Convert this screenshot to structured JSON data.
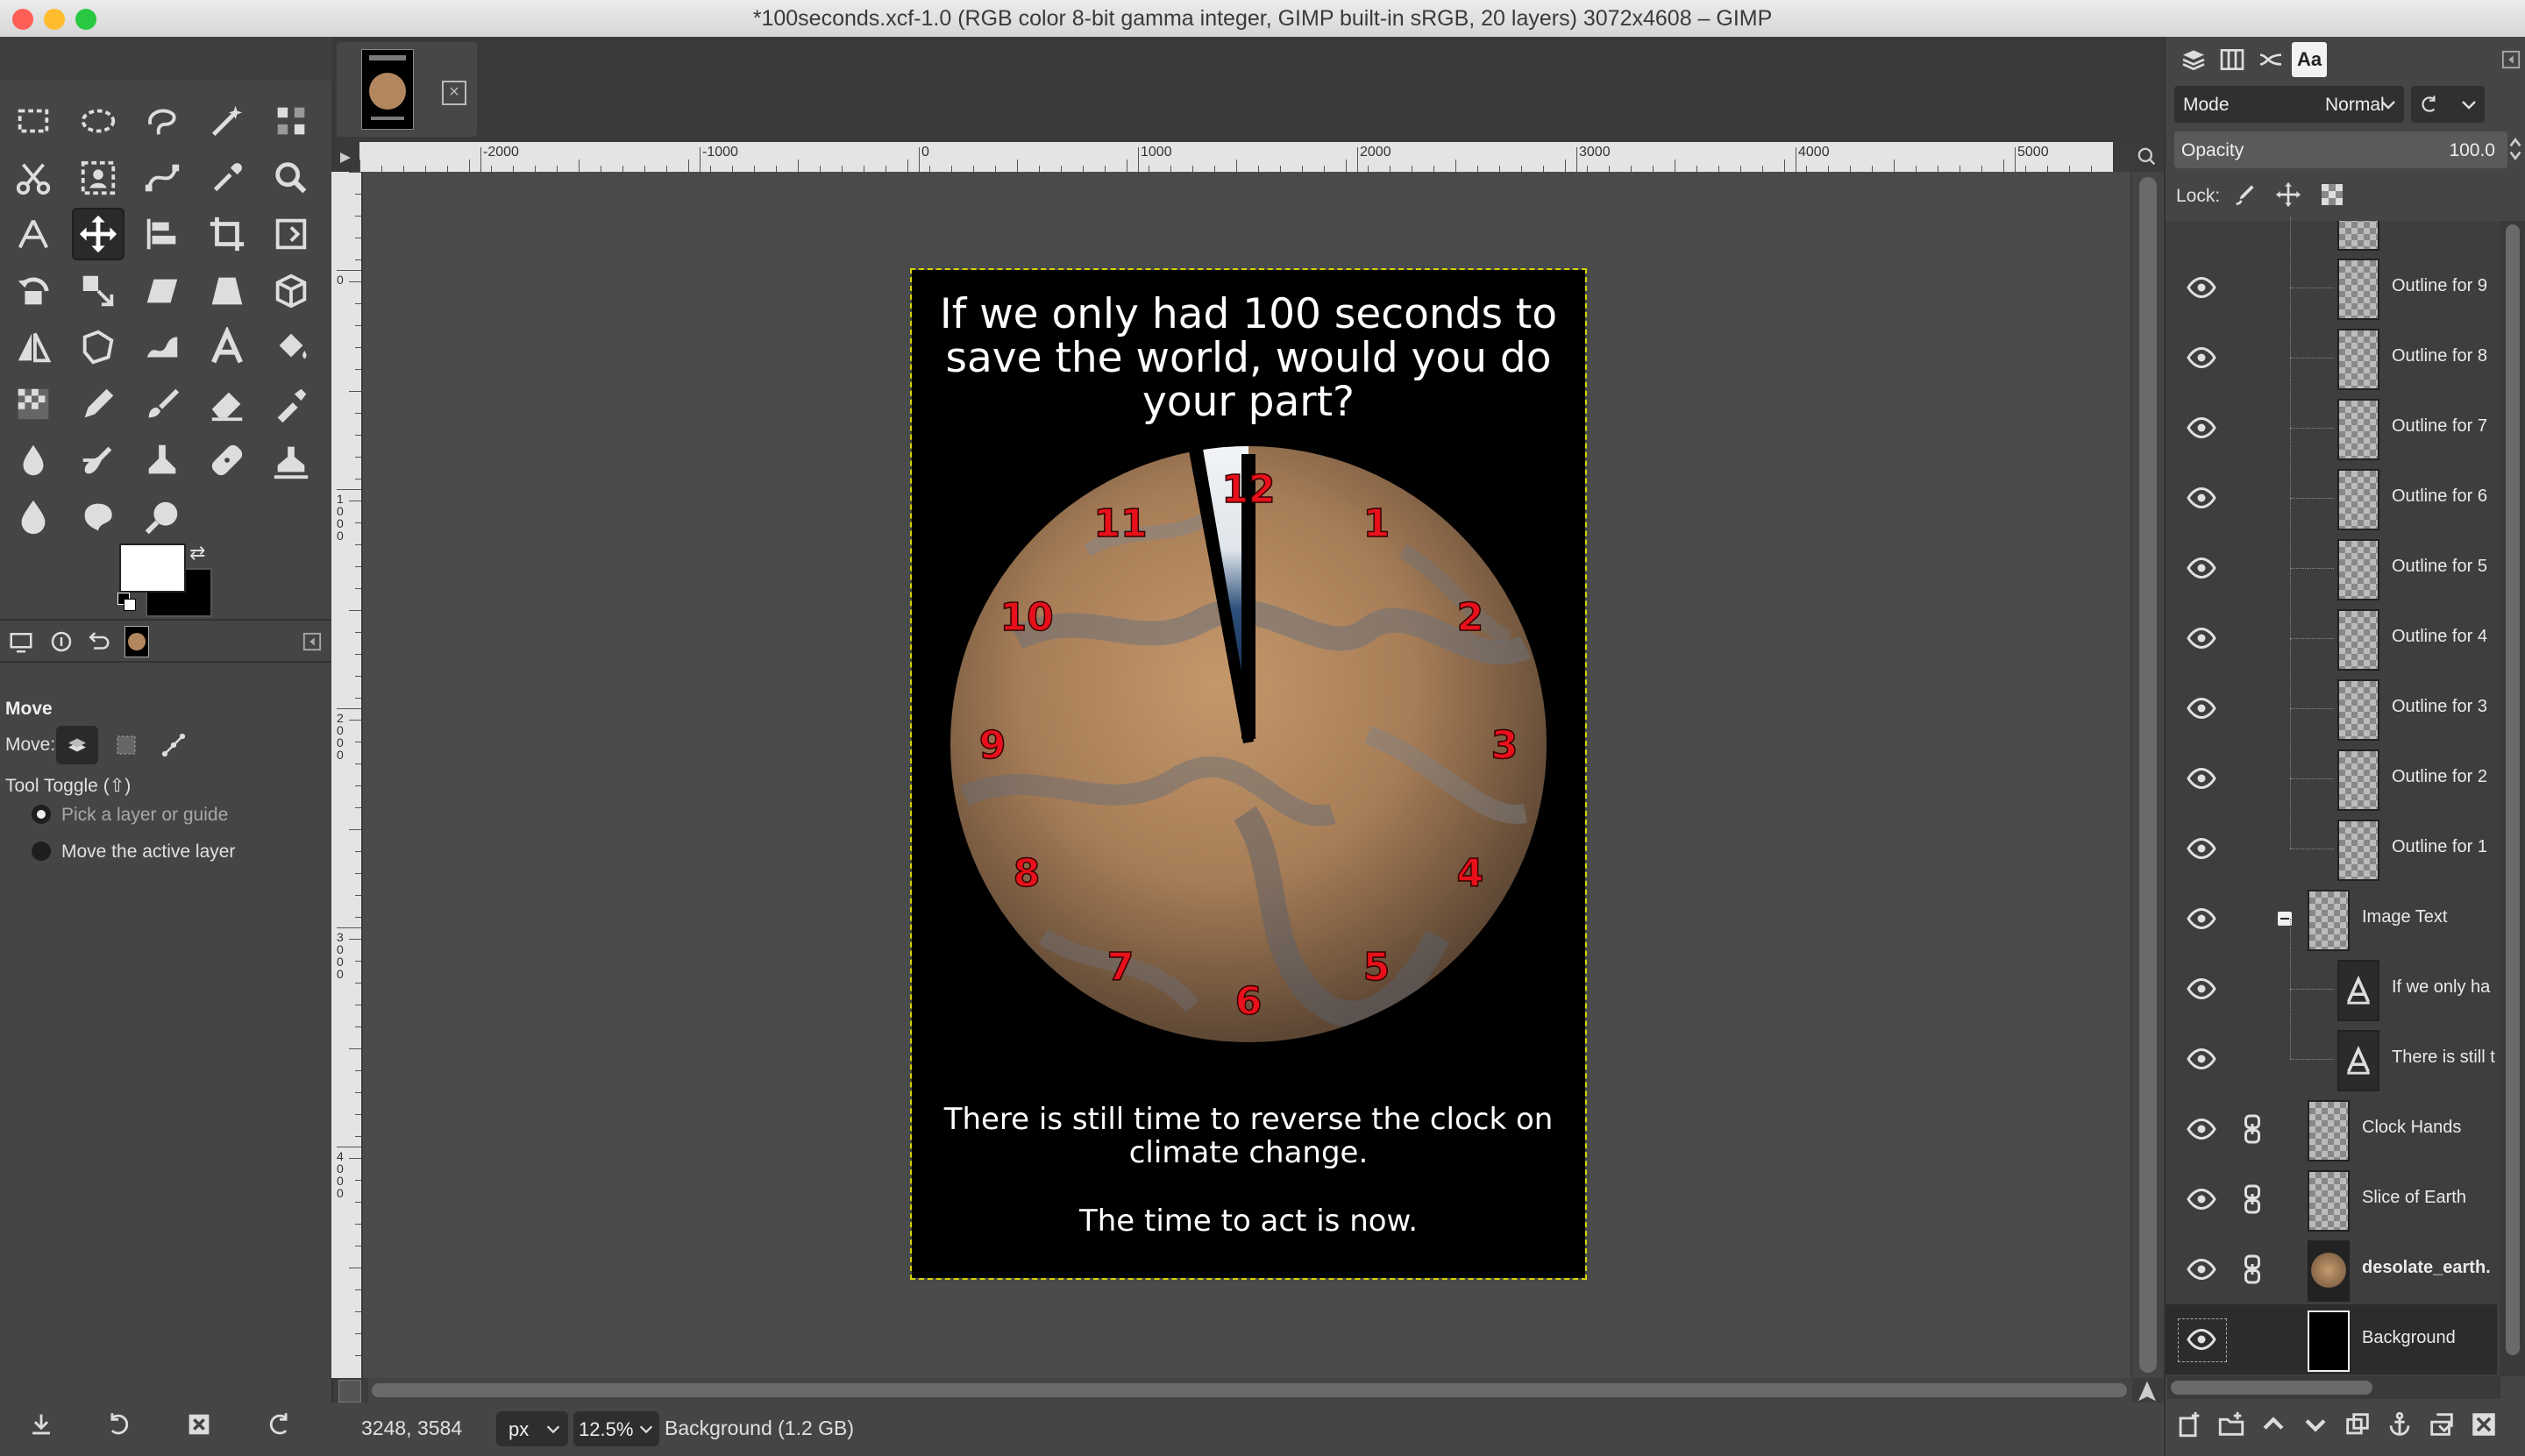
{
  "window": {
    "title": "*100seconds.xcf-1.0 (RGB color 8-bit gamma integer, GIMP built-in sRGB, 20 layers) 3072x4608 – GIMP",
    "traffic_lights": {
      "close": "#ff5f57",
      "minimize": "#febc2e",
      "zoom": "#28c840"
    }
  },
  "toolbox": {
    "tools": [
      "rect-select-icon",
      "ellipse-select-icon",
      "free-select-icon",
      "fuzzy-select-icon",
      "select-by-color-icon",
      "scissors-icon",
      "foreground-select-icon",
      "paths-icon",
      "color-picker-icon",
      "zoom-icon",
      "measure-icon",
      "move-icon",
      "align-icon",
      "crop-icon",
      "unified-transform-icon",
      "rotate-icon",
      "scale-icon",
      "shear-icon",
      "perspective-icon",
      "3d-transform-icon",
      "flip-icon",
      "cage-icon",
      "warp-icon",
      "text-icon",
      "bucket-fill-icon",
      "gradient-icon",
      "pencil-icon",
      "paintbrush-icon",
      "eraser-icon",
      "airbrush-icon",
      "ink-icon",
      "mypaint-brush-icon",
      "clone-icon",
      "heal-icon",
      "perspective-clone-icon",
      "blur-icon",
      "smudge-icon",
      "dodge-burn-icon"
    ],
    "active_tool": "move-icon",
    "fg_color": "#ffffff",
    "bg_color": "#000000"
  },
  "tool_options": {
    "title": "Move",
    "move_label": "Move:",
    "toggle_label": "Tool Toggle  (⇧)",
    "options": [
      {
        "label": "Pick a layer or guide",
        "selected": true
      },
      {
        "label": "Move the active layer",
        "selected": false
      }
    ]
  },
  "ruler": {
    "top_labels": [
      "-2000",
      "-1000",
      "0",
      "1000",
      "2000",
      "3000",
      "4000",
      "5000"
    ],
    "left_labels": [
      "0",
      "1000",
      "2000",
      "3000",
      "4000"
    ]
  },
  "poster": {
    "headline": "If we only had 100 seconds to save the world, would you do your part?",
    "footer1": "There is still time to reverse the clock on climate change.",
    "footer2": "The time to act is now.",
    "clock_numbers": [
      "12",
      "1",
      "2",
      "3",
      "4",
      "5",
      "6",
      "7",
      "8",
      "9",
      "10",
      "11"
    ],
    "number_color": "#e8101a"
  },
  "status": {
    "coords": "3248, 3584",
    "unit": "px",
    "zoom": "12.5%",
    "layer_info": "Background (1.2 GB)"
  },
  "layers_panel": {
    "mode_label": "Mode",
    "mode_value": "Normal",
    "opacity_label": "Opacity",
    "opacity_value": "100.0",
    "lock_label": "Lock:",
    "layers": [
      {
        "name": "Outline for 9",
        "type": "layer",
        "indent": 2
      },
      {
        "name": "Outline for 8",
        "type": "layer",
        "indent": 2
      },
      {
        "name": "Outline for 7",
        "type": "layer",
        "indent": 2
      },
      {
        "name": "Outline for 6",
        "type": "layer",
        "indent": 2
      },
      {
        "name": "Outline for 5",
        "type": "layer",
        "indent": 2
      },
      {
        "name": "Outline for 4",
        "type": "layer",
        "indent": 2
      },
      {
        "name": "Outline for 3",
        "type": "layer",
        "indent": 2
      },
      {
        "name": "Outline for 2",
        "type": "layer",
        "indent": 2
      },
      {
        "name": "Outline for 1",
        "type": "layer",
        "indent": 2
      },
      {
        "name": "Image Text",
        "type": "group",
        "indent": 1
      },
      {
        "name": "If we only ha",
        "type": "text",
        "indent": 2
      },
      {
        "name": "There is still t",
        "type": "text",
        "indent": 2
      },
      {
        "name": "Clock Hands",
        "type": "layer",
        "indent": 1,
        "chain": true
      },
      {
        "name": "Slice of Earth",
        "type": "layer",
        "indent": 1,
        "chain": true
      },
      {
        "name": "desolate_earth.",
        "type": "image",
        "indent": 1,
        "chain": true,
        "bold": true
      },
      {
        "name": "Background",
        "type": "black",
        "indent": 1,
        "selected": true
      }
    ]
  }
}
